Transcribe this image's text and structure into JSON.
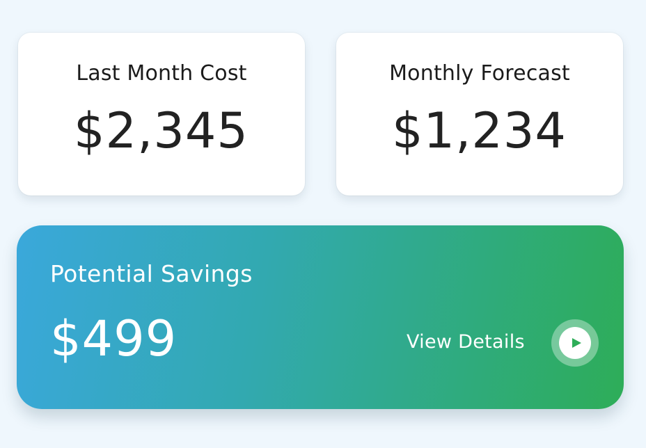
{
  "cards": [
    {
      "title": "Last Month Cost",
      "value": "$2,345"
    },
    {
      "title": "Monthly Forecast",
      "value": "$1,234"
    }
  ],
  "savings": {
    "title": "Potential Savings",
    "value": "$499",
    "details_label": "View Details",
    "details_icon": "play-icon"
  },
  "colors": {
    "background": "#eff7fd",
    "card": "#ffffff",
    "text_dark": "#222222",
    "gradient_start": "#3aa8db",
    "gradient_end": "#2ead58",
    "play_icon": "#2ead58"
  }
}
